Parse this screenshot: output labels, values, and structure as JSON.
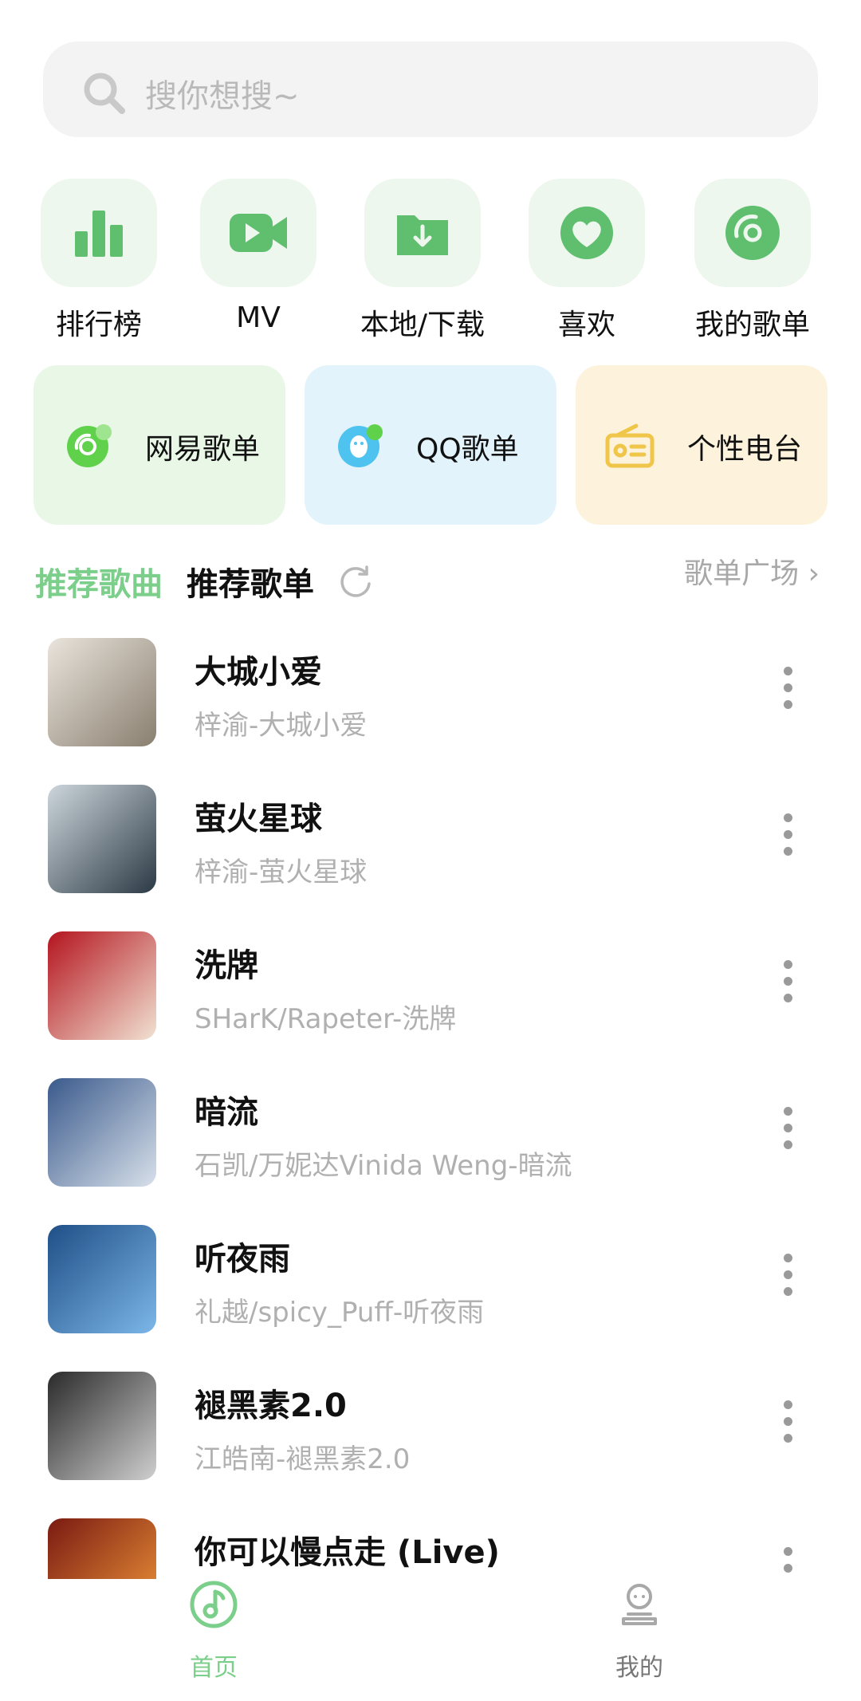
{
  "search": {
    "placeholder": "搜你想搜~",
    "icon": "search-icon"
  },
  "quick_actions": [
    {
      "label": "排行榜",
      "icon": "chart-bars-icon"
    },
    {
      "label": "MV",
      "icon": "video-camera-icon"
    },
    {
      "label": "本地/下载",
      "icon": "download-folder-icon"
    },
    {
      "label": "喜欢",
      "icon": "heart-icon"
    },
    {
      "label": "我的歌单",
      "icon": "disc-icon"
    }
  ],
  "cards": [
    {
      "label": "网易歌单",
      "icon": "netease-music-icon",
      "bg": "#e8f7e6"
    },
    {
      "label": "QQ歌单",
      "icon": "qq-penguin-icon",
      "bg": "#e3f3fb"
    },
    {
      "label": "个性电台",
      "icon": "radio-icon",
      "bg": "#fdf3dc"
    }
  ],
  "section": {
    "tab_active": "推荐歌曲",
    "tab_other": "推荐歌单",
    "plaza": "歌单广场 ›"
  },
  "songs": [
    {
      "title": "大城小爱",
      "subtitle": "梓渝-大城小爱",
      "cover_colors": [
        "#e9e4dc",
        "#8a7f70"
      ]
    },
    {
      "title": "萤火星球",
      "subtitle": "梓渝-萤火星球",
      "cover_colors": [
        "#cdd6dc",
        "#2c3a45"
      ]
    },
    {
      "title": "洗牌",
      "subtitle": "SHarK/Rapeter-洗牌",
      "cover_colors": [
        "#b4141e",
        "#f1e2d2"
      ]
    },
    {
      "title": "暗流",
      "subtitle": "石凯/万妮达Vinida Weng-暗流",
      "cover_colors": [
        "#3a5a8c",
        "#d8e0ea"
      ]
    },
    {
      "title": "听夜雨",
      "subtitle": "礼越/spicy_Puff-听夜雨",
      "cover_colors": [
        "#1f4f86",
        "#7cb6e8"
      ]
    },
    {
      "title": "褪黑素2.0",
      "subtitle": "江皓南-褪黑素2.0",
      "cover_colors": [
        "#2a2a2a",
        "#cfcfcf"
      ]
    },
    {
      "title": "你可以慢点走 (Live)",
      "subtitle": "",
      "cover_colors": [
        "#7a1a12",
        "#f29a3a"
      ]
    }
  ],
  "bottom_nav": [
    {
      "label": "首页",
      "icon": "music-note-disc-icon",
      "active": true
    },
    {
      "label": "我的",
      "icon": "user-profile-icon",
      "active": false
    }
  ],
  "colors": {
    "accent": "#7ccf8a",
    "icon_green": "#5fbf6f"
  }
}
